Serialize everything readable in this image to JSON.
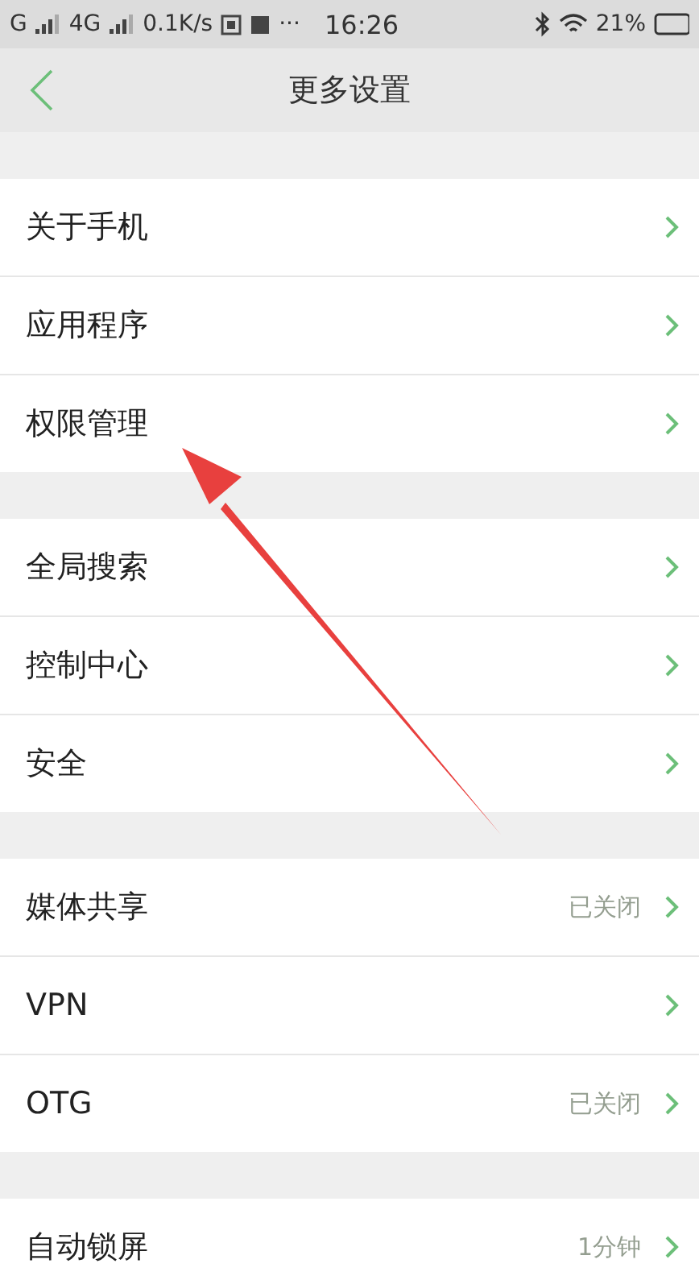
{
  "status_bar": {
    "left": [
      "G",
      "4G",
      "0.1K/s"
    ],
    "dots": "···",
    "time": "16:26",
    "battery": "21%"
  },
  "nav": {
    "title": "更多设置"
  },
  "groups": [
    {
      "rows": [
        {
          "label": "关于手机"
        },
        {
          "label": "应用程序"
        },
        {
          "label": "权限管理"
        }
      ]
    },
    {
      "rows": [
        {
          "label": "全局搜索"
        },
        {
          "label": "控制中心"
        },
        {
          "label": "安全"
        }
      ]
    },
    {
      "rows": [
        {
          "label": "媒体共享",
          "value": "已关闭"
        },
        {
          "label": "VPN"
        },
        {
          "label": "OTG",
          "value": "已关闭"
        }
      ]
    },
    {
      "rows": [
        {
          "label": "自动锁屏",
          "value": "1分钟"
        }
      ]
    }
  ],
  "annotations": [
    {
      "kind": "arrow"
    }
  ]
}
